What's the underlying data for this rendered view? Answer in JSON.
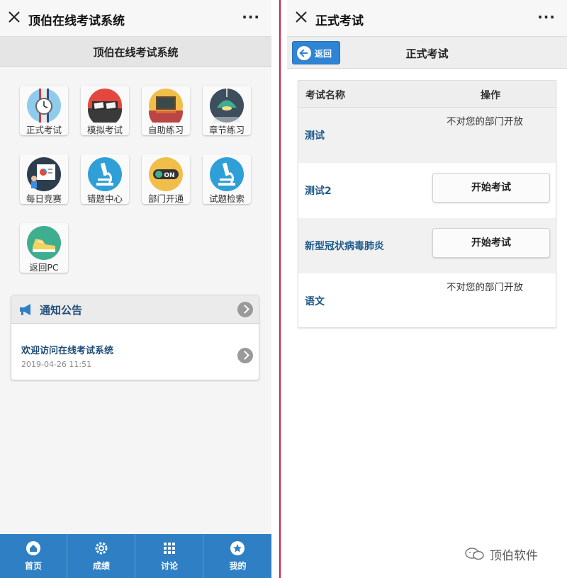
{
  "left": {
    "window_title": "顶伯在线考试系统",
    "more": "···",
    "header_title": "顶伯在线考试系统",
    "tiles": [
      {
        "label": "正式考试"
      },
      {
        "label": "模拟考试"
      },
      {
        "label": "自助练习"
      },
      {
        "label": "章节练习"
      },
      {
        "label": "每日竞赛"
      },
      {
        "label": "错题中心"
      },
      {
        "label": "部门开通"
      },
      {
        "label": "试题检索"
      },
      {
        "label": "返回PC"
      }
    ],
    "toggle_text": "ON",
    "notice": {
      "title": "通知公告",
      "item_title": "欢迎访问在线考试系统",
      "item_date": "2019-04-26 11:51"
    },
    "nav": [
      {
        "label": "首页",
        "icon": "home-icon"
      },
      {
        "label": "成绩",
        "icon": "gear-icon"
      },
      {
        "label": "讨论",
        "icon": "grid-icon"
      },
      {
        "label": "我的",
        "icon": "star-icon"
      }
    ]
  },
  "right": {
    "window_title": "正式考试",
    "more": "···",
    "back_label": "返回",
    "header_title": "正式考试",
    "table": {
      "col_name": "考试名称",
      "col_action": "操作",
      "rows": [
        {
          "name": "测试",
          "status": "不对您的部门开放"
        },
        {
          "name": "测试2",
          "button": "开始考试"
        },
        {
          "name": "新型冠状病毒肺炎",
          "button": "开始考试"
        },
        {
          "name": "语文",
          "status": "不对您的部门开放"
        }
      ]
    },
    "watermark": "顶伯软件"
  },
  "colors": {
    "accent_blue": "#2f7fc5",
    "title_blue": "#1e4d78",
    "divider_red": "#c8204a"
  }
}
